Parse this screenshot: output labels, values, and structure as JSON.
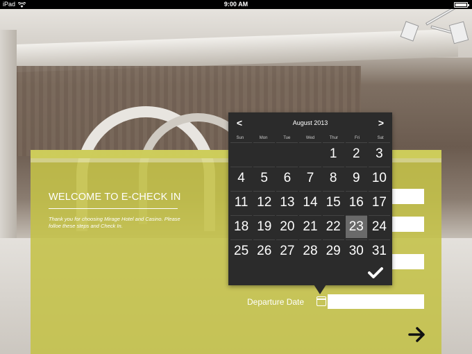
{
  "statusbar": {
    "device": "iPad",
    "time": "9:00 AM"
  },
  "welcome": {
    "title": "WELCOME TO E-CHECK IN",
    "message": "Thank you for choosing Mirage Hotel and Casino. Please folloe these steps and Check In."
  },
  "form": {
    "departure_label": "Departure Date",
    "departure_value": ""
  },
  "calendar": {
    "month": "August 2013",
    "prev": "<",
    "next": ">",
    "weekdays": [
      "Sun",
      "Mon",
      "Tue",
      "Wed",
      "Thur",
      "Fri",
      "Sat"
    ],
    "days": [
      "",
      "",
      "",
      "",
      "1",
      "2",
      "3",
      "4",
      "5",
      "6",
      "7",
      "8",
      "9",
      "10",
      "11",
      "12",
      "13",
      "14",
      "15",
      "16",
      "17",
      "18",
      "19",
      "20",
      "21",
      "22",
      "23",
      "24",
      "25",
      "26",
      "27",
      "28",
      "29",
      "30",
      "31"
    ],
    "selected": "23"
  },
  "colors": {
    "panel": "#c4c248",
    "calendar_bg": "#2b2b2b",
    "selected_day": "#6a6a6a"
  },
  "icons": {
    "wifi": "wifi-icon",
    "battery": "battery-icon",
    "calendar": "calendar-icon",
    "confirm": "checkmark-icon",
    "next": "arrow-right-icon"
  }
}
